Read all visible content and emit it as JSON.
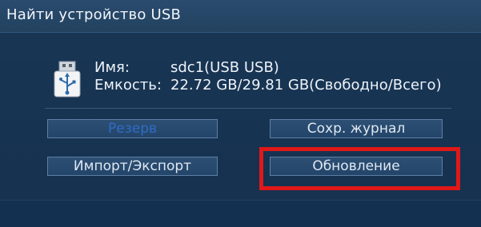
{
  "dialog": {
    "title": "Найти устройство USB"
  },
  "device": {
    "icon": "usb-drive-icon",
    "name_label": "Имя:",
    "name_value": "sdc1(USB USB)",
    "capacity_label": "Емкость:",
    "capacity_value": "22.72 GB/29.81 GB(Свободно/Всего)"
  },
  "buttons": {
    "backup": "Резерв",
    "save_log": "Сохр. журнал",
    "import_export": "Импорт/Экспорт",
    "update": "Обновление"
  },
  "colors": {
    "background": "#173352",
    "titlebar": "#22425f",
    "highlight": "#e01818",
    "backup_text": "#2f6cc6"
  }
}
